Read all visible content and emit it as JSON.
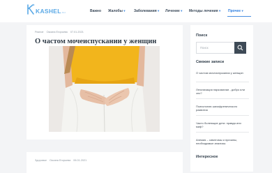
{
  "header": {
    "logo_text": "KASHEL",
    "logo_suffix": ".su",
    "nav": [
      {
        "label": "Важно",
        "caret": ""
      },
      {
        "label": "Жалобы",
        "caret": "▾"
      },
      {
        "label": "Заболевания",
        "caret": "▾"
      },
      {
        "label": "Лечение",
        "caret": "▾"
      },
      {
        "label": "Методы лечения",
        "caret": "▾"
      },
      {
        "label": "Прочее",
        "caret": "▾"
      }
    ]
  },
  "post": {
    "meta": {
      "category": "Разное",
      "author": "Оксана Егорьева",
      "date": "07.01.2021"
    },
    "title": "О частом мочеиспускании у женщин"
  },
  "post2": {
    "meta": {
      "category": "Здоровье",
      "author": "Оксана Егорьева",
      "date": "06.01.2021"
    }
  },
  "sidebar": {
    "search_heading": "Поиск",
    "search_placeholder": "Поиск",
    "recent_heading": "Свежие записи",
    "recent": [
      "О частом мочеиспускании у женщин",
      "Легализация наркомании - добро или зло?",
      "Психологию шизофренического развития",
      "Часто болеющие дети: правда или миф?",
      "Анемия – симптомы и причины, необходимые анализы"
    ],
    "interesting_heading": "Интересное"
  }
}
